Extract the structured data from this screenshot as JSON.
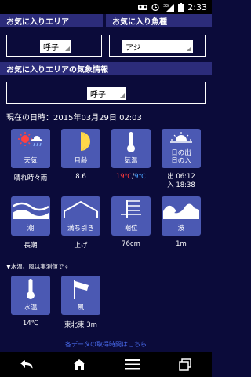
{
  "status_bar": {
    "time": "2:33",
    "network": "3G"
  },
  "favorite_area": {
    "header": "お気に入りエリア",
    "selected": "呼子"
  },
  "favorite_fish": {
    "header": "お気に入り魚種",
    "selected": "アジ"
  },
  "weather_area": {
    "header": "お気に入りエリアの気象情報",
    "selected": "呼子"
  },
  "datetime": "現在の日時：2015年03月29日 02:03",
  "tiles": {
    "weather": {
      "label": "天気",
      "value": "晴れ時々雨"
    },
    "moon": {
      "label": "月齢",
      "value": "8.6"
    },
    "temp": {
      "label": "気温",
      "value_high": "19℃",
      "value_sep": "/",
      "value_low": "9℃"
    },
    "sun": {
      "label_line1": "日の出",
      "label_line2": "日の入",
      "rise": "出 06:12",
      "set": "入 18:38"
    },
    "tide": {
      "label": "潮",
      "value": "長潮"
    },
    "ebb": {
      "label": "満ち引き",
      "value": "上げ"
    },
    "tide_level": {
      "label": "潮位",
      "value": "76cm"
    },
    "wave": {
      "label": "波",
      "value": "1m"
    },
    "water_temp": {
      "label": "水温",
      "value": "14℃"
    },
    "wind": {
      "label": "風",
      "value": "東北東 3m"
    }
  },
  "note": "▼水温、風は実測値です",
  "link": "各データの取得時間はこちら",
  "colors": {
    "background": "#0b0b3a",
    "header": "#2c2c7a",
    "tile": "#4b59b3",
    "temp_high": "#ff3b3b",
    "temp_low": "#4aa3ff",
    "link": "#4a6cf0"
  },
  "nav": {
    "back_icon": "back-arrow-icon",
    "home_icon": "home-icon",
    "menu_icon": "menu-icon",
    "recents_icon": "recent-apps-icon"
  }
}
